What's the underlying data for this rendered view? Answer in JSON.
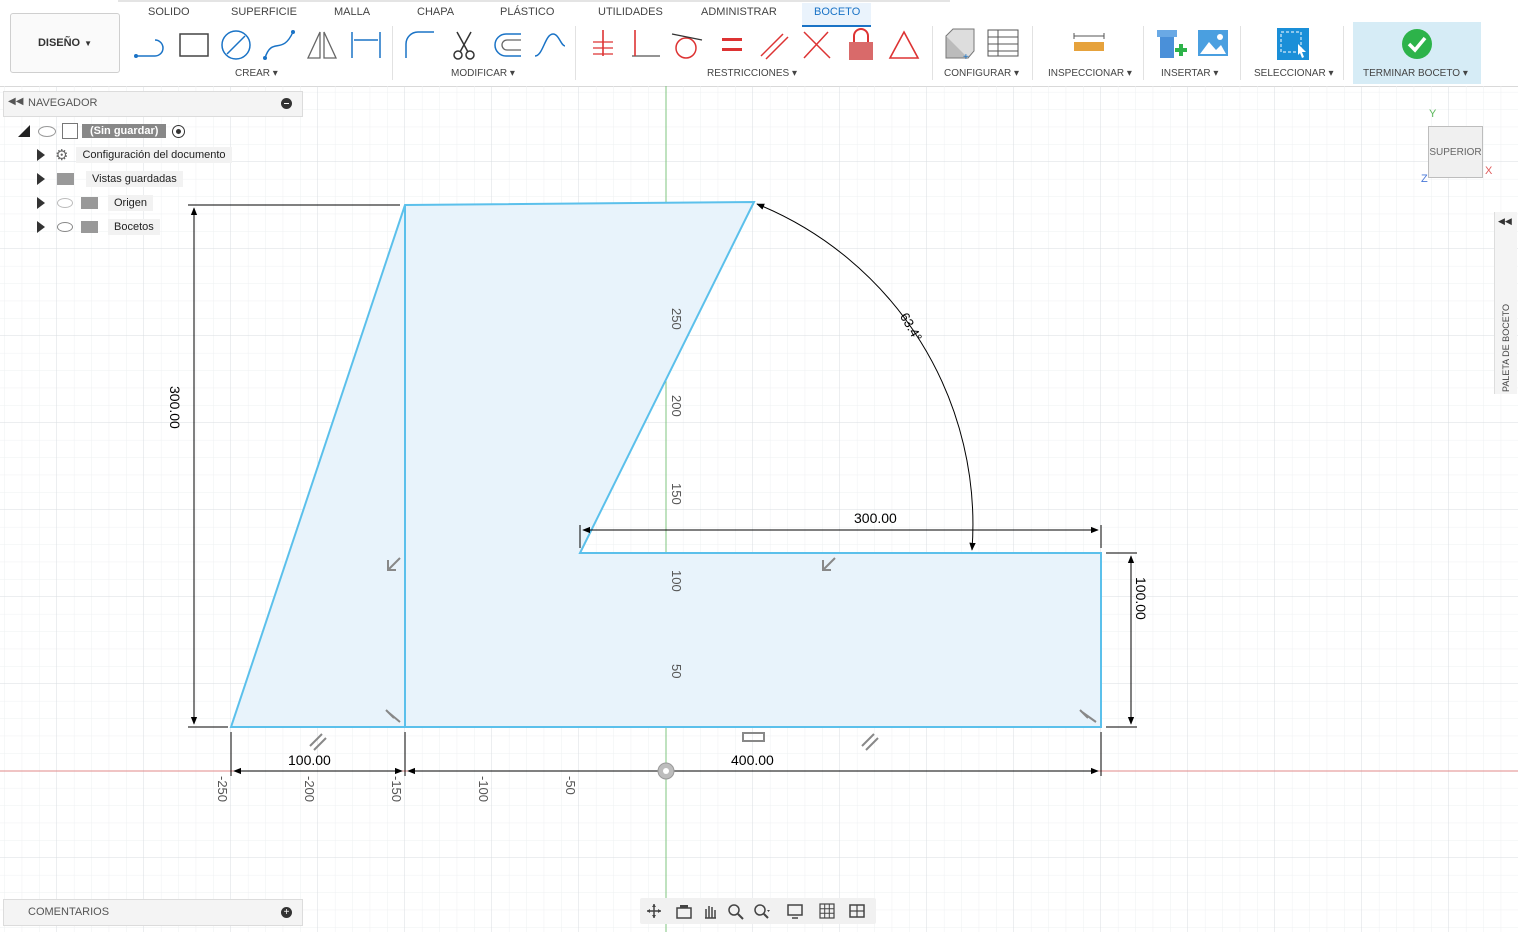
{
  "tabs": [
    "SOLIDO",
    "SUPERFICIE",
    "MALLA",
    "CHAPA",
    "PLÁSTICO",
    "UTILIDADES",
    "ADMINISTRAR",
    "BOCETO"
  ],
  "active_tab": "BOCETO",
  "workspace": "DISEÑO",
  "groups": {
    "crear": "CREAR",
    "modificar": "MODIFICAR",
    "restricciones": "RESTRICCIONES",
    "configurar": "CONFIGURAR",
    "inspeccionar": "INSPECCIONAR",
    "insertar": "INSERTAR",
    "seleccionar": "SELECCIONAR",
    "terminar": "TERMINAR BOCETO"
  },
  "browser": {
    "title": "NAVEGADOR",
    "root": "(Sin guardar)",
    "items": [
      "Configuración del documento",
      "Vistas guardadas",
      "Origen",
      "Bocetos"
    ]
  },
  "comments": "COMENTARIOS",
  "viewcube": {
    "face": "SUPERIOR",
    "x": "X",
    "y": "Y",
    "z": "Z"
  },
  "palette": "PALETA DE BOCETO",
  "dimensions": {
    "height_left": "300.00",
    "top_width": "300.00",
    "right_height": "100.00",
    "bottom_left": "100.00",
    "bottom_right": "400.00",
    "angle": "63.4°"
  },
  "ruler_vertical": [
    "250",
    "200",
    "150",
    "100",
    "50"
  ],
  "ruler_horizontal": [
    "-250",
    "-200",
    "-150",
    "-100",
    "-50"
  ],
  "colors": {
    "accent": "#1a73c6",
    "sketch": "#5bc0eb",
    "fill": "#e8f3fb",
    "finish_bg": "#d6ecf6",
    "check": "#2db34a"
  }
}
